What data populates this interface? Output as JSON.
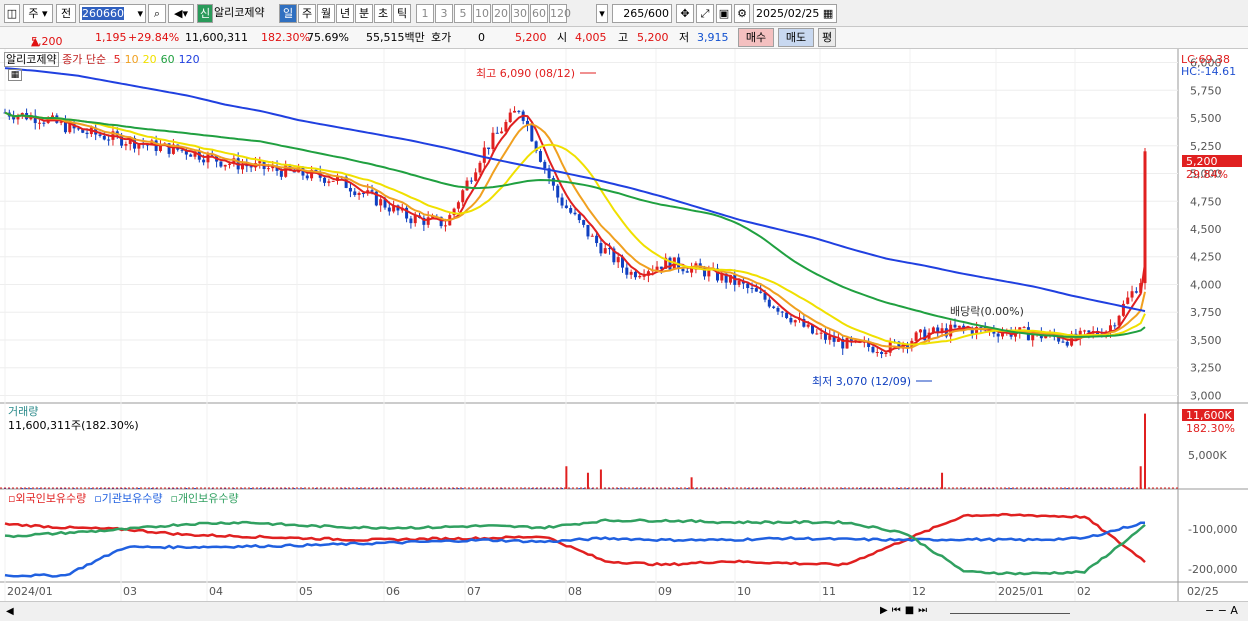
{
  "toolbar": {
    "mode_btn": "주",
    "front_btn": "전",
    "code": "260660",
    "new_badge": "신",
    "stock_name": "알리코제약",
    "periods": [
      "일",
      "주",
      "월",
      "년",
      "분",
      "초",
      "틱"
    ],
    "intervals": [
      "1",
      "3",
      "5",
      "10",
      "20",
      "30",
      "60",
      "120"
    ],
    "count": "265",
    "count_total": "/600",
    "date": "2025/02/25"
  },
  "quote": {
    "price": "5,200",
    "change": "1,195",
    "change_pct": "+29.84%",
    "volume": "11,600,311",
    "vol_ratio": "182.30%",
    "turnover": "75.69%",
    "amount": "55,515백만",
    "ask_label": "호가",
    "ask_value": "0",
    "bid_price": "5,200",
    "open_label": "시",
    "open": "4,005",
    "high_label": "고",
    "high": "5,200",
    "low_label": "저",
    "low": "3,915",
    "buy": "매수",
    "sell": "매도",
    "avg": "평"
  },
  "price_panel": {
    "title": "알리코제약",
    "ma_label": "종가 단순",
    "ma_periods": [
      "5",
      "10",
      "20",
      "60",
      "120"
    ],
    "ma_colors": [
      "#e02020",
      "#f0a020",
      "#f0e000",
      "#20a040",
      "#2040e0"
    ],
    "lc_label": "LC:69.38",
    "hc_label": "HC:-14.61",
    "high_note": "최고 6,090 (08/12)",
    "low_note": "최저 3,070 (12/09)",
    "dividend_note": "배당락(0.00%)",
    "price_tag": "5,200",
    "pct_tag": "29.84%",
    "y_ticks": [
      "6,000",
      "5,750",
      "5,500",
      "5,250",
      "5,000",
      "4,750",
      "4,500",
      "4,250",
      "4,000",
      "3,750",
      "3,500",
      "3,250",
      "3,000"
    ]
  },
  "volume_panel": {
    "title": "거래량",
    "value": "11,600,311주(182.30%)",
    "tag": "11,600K",
    "tag_pct": "182.30%",
    "y_tick": "5,000K"
  },
  "holding_panel": {
    "labels": [
      "외국인보유수량",
      "기관보유수량",
      "개인보유수량"
    ],
    "colors": [
      "#e02020",
      "#2060e0",
      "#30a060"
    ],
    "y_ticks": [
      "-100,000",
      "-200,000"
    ]
  },
  "x_axis": [
    "2024/01",
    "03",
    "04",
    "05",
    "06",
    "07",
    "08",
    "09",
    "10",
    "11",
    "12",
    "2025/01",
    "02",
    "02/25"
  ],
  "chart_data": [
    {
      "type": "line",
      "title": "알리코제약",
      "series": [
        {
          "name": "5",
          "values": [
            5550,
            5500,
            5380,
            5320,
            5250,
            5200,
            5100,
            5050,
            5000,
            4950,
            4780,
            4600,
            4550,
            5200,
            5600,
            4800,
            4400,
            4100,
            4200,
            4120,
            4000,
            3800,
            3550,
            3450,
            3430,
            3550,
            3600,
            3580,
            3550,
            3500,
            3600,
            4100
          ]
        },
        {
          "name": "120",
          "values": [
            5950,
            5920,
            5880,
            5820,
            5760,
            5700,
            5620,
            5560,
            5480,
            5420,
            5360,
            5300,
            5230,
            5150,
            5080,
            5020,
            4950,
            4870,
            4780,
            4680,
            4580,
            4500,
            4420,
            4320,
            4230,
            4170,
            4100,
            4040,
            3980,
            3900,
            3830,
            3760
          ]
        }
      ],
      "ylim": [
        2950,
        6050
      ]
    },
    {
      "type": "bar",
      "title": "거래량",
      "x": [
        "2024/08",
        "2024/12",
        "2025/02/25"
      ],
      "values": [
        3500,
        1500,
        11600
      ],
      "ylabel": "K"
    },
    {
      "type": "line",
      "title": "보유수량",
      "series": [
        {
          "name": "외국인보유수량",
          "values": [
            -85000,
            -95000,
            -100000,
            -115000,
            -120000,
            -125000,
            -130000,
            -127000,
            -125000,
            -120000,
            -190000,
            -200000,
            -190000,
            -195000,
            -200000,
            -130000,
            -60000,
            -60000,
            -65000,
            -190000
          ]
        },
        {
          "name": "기관보유수량",
          "values": [
            -230000,
            -230000,
            -150000,
            -150000,
            -148000,
            -145000,
            -140000,
            -135000,
            -130000,
            -135000,
            -125000,
            -130000,
            -130000,
            -125000,
            -128000,
            -130000,
            -128000,
            -130000,
            -125000,
            -80000
          ]
        },
        {
          "name": "개인보유수량",
          "values": [
            -120000,
            -110000,
            -100000,
            -85000,
            -80000,
            -90000,
            -95000,
            -95000,
            -90000,
            -95000,
            -75000,
            -75000,
            -80000,
            -80000,
            -80000,
            -110000,
            -220000,
            -225000,
            -220000,
            -90000
          ]
        }
      ],
      "ylim": [
        -240000,
        -20000
      ]
    }
  ]
}
